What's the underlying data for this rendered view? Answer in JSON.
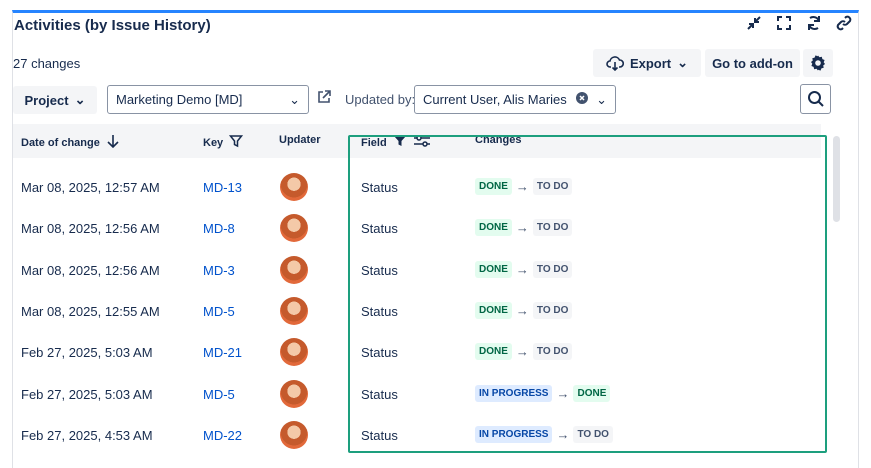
{
  "title": "Activities (by Issue History)",
  "changes_count": "27 changes",
  "toolbar": {
    "export_label": "Export",
    "addon_label": "Go to add-on",
    "project_label": "Project",
    "project_value": "Marketing Demo [MD]",
    "updated_by_label": "Updated by:",
    "updated_by_value": "Current User, Alis Maries"
  },
  "columns": {
    "date": "Date of change",
    "key": "Key",
    "updater": "Updater",
    "field": "Field",
    "changes": "Changes"
  },
  "rows": [
    {
      "date": "Mar 08, 2025, 12:57 AM",
      "key": "MD-13",
      "field": "Status",
      "from": "DONE",
      "to": "TO DO"
    },
    {
      "date": "Mar 08, 2025, 12:56 AM",
      "key": "MD-8",
      "field": "Status",
      "from": "DONE",
      "to": "TO DO"
    },
    {
      "date": "Mar 08, 2025, 12:56 AM",
      "key": "MD-3",
      "field": "Status",
      "from": "DONE",
      "to": "TO DO"
    },
    {
      "date": "Mar 08, 2025, 12:55 AM",
      "key": "MD-5",
      "field": "Status",
      "from": "DONE",
      "to": "TO DO"
    },
    {
      "date": "Feb 27, 2025, 5:03 AM",
      "key": "MD-21",
      "field": "Status",
      "from": "DONE",
      "to": "TO DO"
    },
    {
      "date": "Feb 27, 2025, 5:03 AM",
      "key": "MD-5",
      "field": "Status",
      "from": "IN PROGRESS",
      "to": "DONE"
    },
    {
      "date": "Feb 27, 2025, 4:53 AM",
      "key": "MD-22",
      "field": "Status",
      "from": "IN PROGRESS",
      "to": "TO DO"
    }
  ],
  "colors": {
    "accent": "#2684ff",
    "highlight": "#1d9f7e",
    "link": "#0052cc"
  }
}
